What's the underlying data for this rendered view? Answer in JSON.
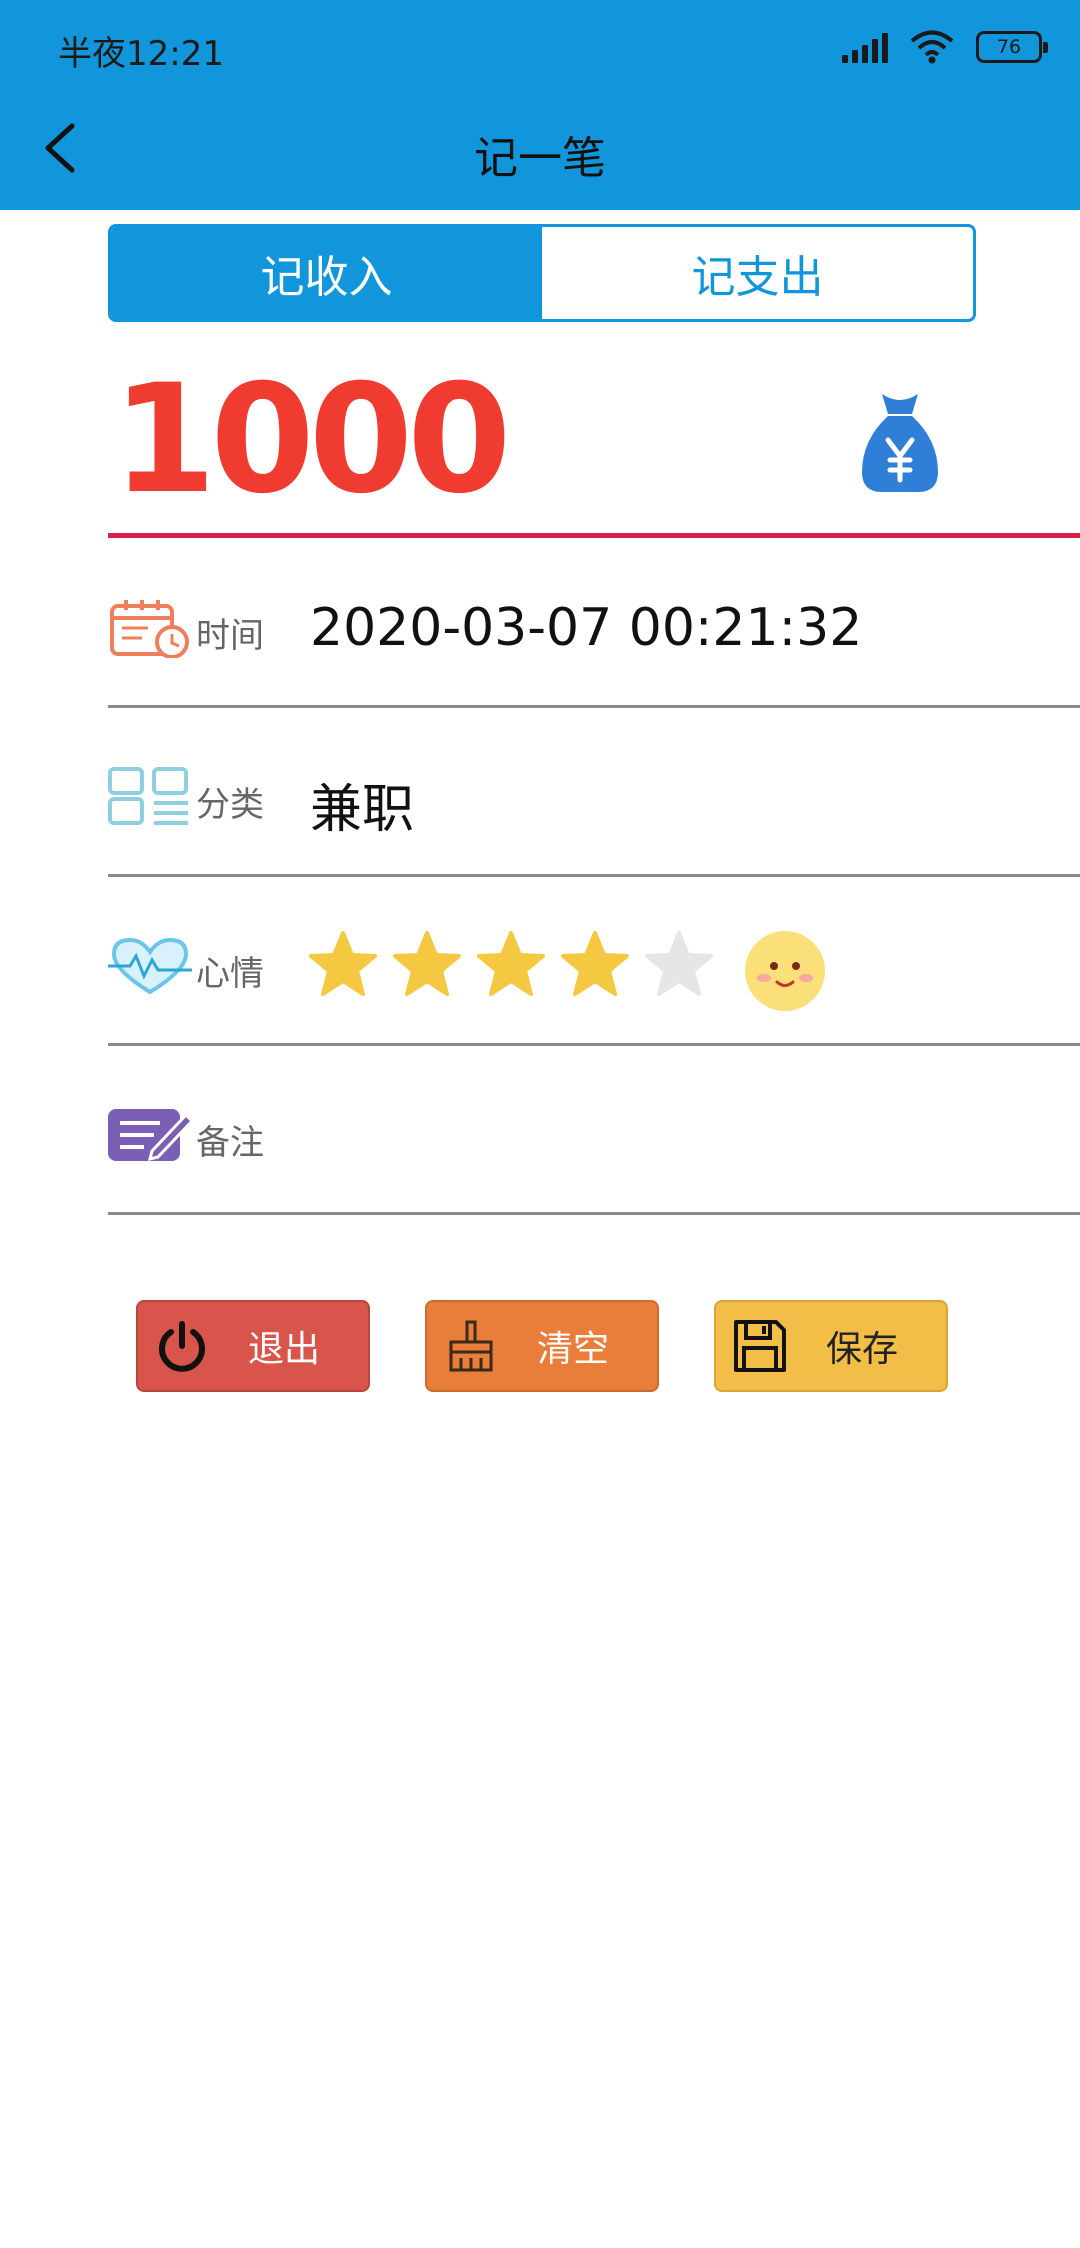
{
  "status_bar": {
    "time": "半夜12:21",
    "battery": "76"
  },
  "header": {
    "title": "记一笔"
  },
  "tabs": [
    {
      "label": "记收入",
      "active": true
    },
    {
      "label": "记支出",
      "active": false
    }
  ],
  "amount": "1000",
  "form": {
    "time": {
      "label": "时间",
      "value": "2020-03-07 00:21:32",
      "icon": "calendar-clock-icon"
    },
    "category": {
      "label": "分类",
      "value": "兼职",
      "icon": "category-grid-icon"
    },
    "mood": {
      "label": "心情",
      "rating": 4,
      "max_rating": 5,
      "icon": "heart-pulse-icon"
    },
    "note": {
      "label": "备注",
      "value": "",
      "icon": "edit-note-icon"
    }
  },
  "buttons": {
    "exit": {
      "label": "退出",
      "icon": "power-icon"
    },
    "clear": {
      "label": "清空",
      "icon": "broom-icon"
    },
    "save": {
      "label": "保存",
      "icon": "floppy-disk-icon"
    }
  },
  "colors": {
    "primary": "#1296db",
    "amount": "#ef3b30",
    "star_on": "#f5c842",
    "star_off": "#e6e6e6",
    "exit": "#d9554b",
    "clear": "#e87e3a",
    "save": "#f2be47"
  }
}
